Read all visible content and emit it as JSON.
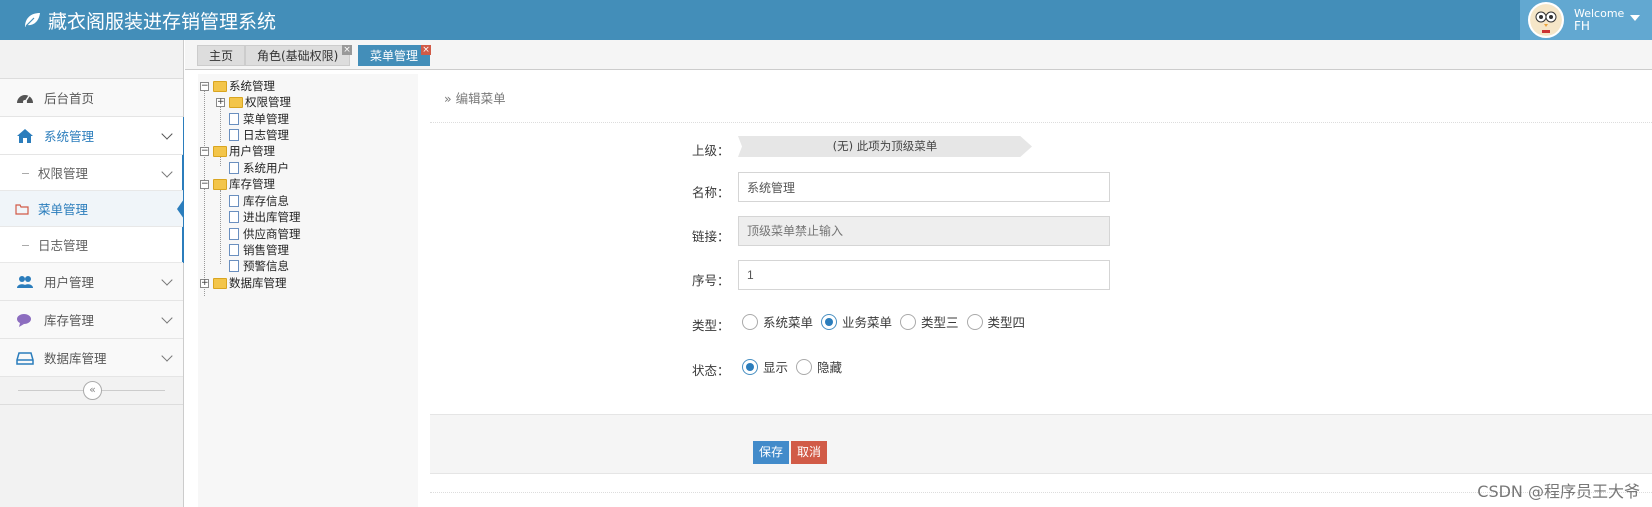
{
  "app": {
    "title": "藏衣阁服装进存销管理系统",
    "welcome": "Welcome",
    "user": "FH"
  },
  "sidebar": {
    "items": [
      {
        "label": "后台首页",
        "icon": "dashboard-icon"
      },
      {
        "label": "系统管理",
        "icon": "home-icon"
      },
      {
        "label": "用户管理",
        "icon": "users-icon"
      },
      {
        "label": "库存管理",
        "icon": "comments-icon"
      },
      {
        "label": "数据库管理",
        "icon": "hdd-icon"
      }
    ],
    "sub_items": [
      {
        "label": "权限管理"
      },
      {
        "label": "菜单管理"
      },
      {
        "label": "日志管理"
      }
    ],
    "collapse": "«"
  },
  "tabs": [
    {
      "label": "主页"
    },
    {
      "label": "角色(基础权限)"
    },
    {
      "label": "菜单管理"
    }
  ],
  "tree": [
    {
      "label": "系统管理"
    },
    {
      "label": "权限管理"
    },
    {
      "label": "菜单管理"
    },
    {
      "label": "日志管理"
    },
    {
      "label": "用户管理"
    },
    {
      "label": "系统用户"
    },
    {
      "label": "库存管理"
    },
    {
      "label": "库存信息"
    },
    {
      "label": "进出库管理"
    },
    {
      "label": "供应商管理"
    },
    {
      "label": "销售管理"
    },
    {
      "label": "预警信息"
    },
    {
      "label": "数据库管理"
    }
  ],
  "form": {
    "breadcrumb": "» 编辑菜单",
    "parent_label": "上级：",
    "parent_value": "(无) 此项为顶级菜单",
    "name_label": "名称：",
    "name_value": "系统管理",
    "link_label": "链接：",
    "link_placeholder": "顶级菜单禁止输入",
    "order_label": "序号：",
    "order_value": "1",
    "type_label": "类型：",
    "type_options": [
      {
        "label": "系统菜单",
        "checked": false
      },
      {
        "label": "业务菜单",
        "checked": true
      },
      {
        "label": "类型三",
        "checked": false
      },
      {
        "label": "类型四",
        "checked": false
      }
    ],
    "status_label": "状态：",
    "status_options": [
      {
        "label": "显示",
        "checked": true
      },
      {
        "label": "隐藏",
        "checked": false
      }
    ],
    "save": "保存",
    "cancel": "取消"
  },
  "watermark": "CSDN @程序员王大爷",
  "colors": {
    "navbar": "#438eb9",
    "accent": "#2b7dbc",
    "save": "#428bca",
    "cancel": "#d15b47"
  }
}
